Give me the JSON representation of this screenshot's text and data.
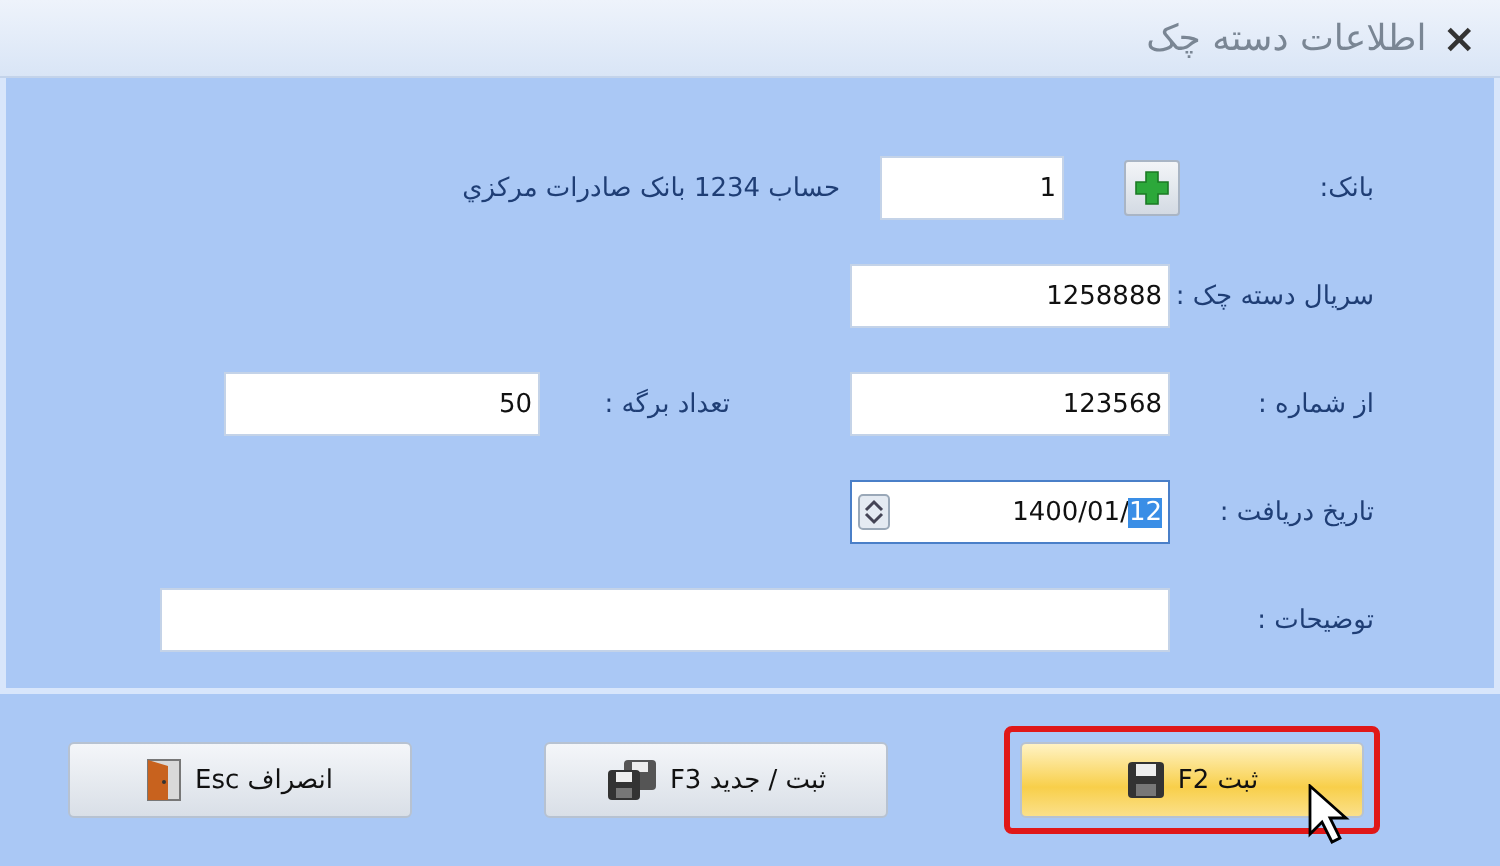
{
  "window": {
    "title": "اطلاعات دسته چک",
    "close": "×"
  },
  "fields": [
    {
      "kind": "bank",
      "label": "بانک:",
      "value": "1",
      "info": "حساب 1234 بانک صادرات مرکزي"
    },
    {
      "kind": "text",
      "label": "سريال دسته چک :",
      "value": "1258888"
    },
    {
      "kind": "pair",
      "label": "از شماره :",
      "value": "123568",
      "second_label": "تعداد برگه :",
      "second_value": "50"
    },
    {
      "kind": "date",
      "label": "تاريخ دريافت :",
      "value": "1400/01/",
      "selected_text": "12",
      "focused": true
    },
    {
      "kind": "wide",
      "label": "توضيحات :"
    }
  ],
  "buttons": [
    {
      "label": "ثبت F2",
      "kind": "save",
      "hovered": true,
      "outlined": true
    },
    {
      "label": "ثبت / جديد F3",
      "kind": "save_new",
      "hovered": false,
      "outlined": false
    },
    {
      "label": "انصراف Esc",
      "kind": "cancel",
      "hovered": false,
      "outlined": false
    }
  ]
}
